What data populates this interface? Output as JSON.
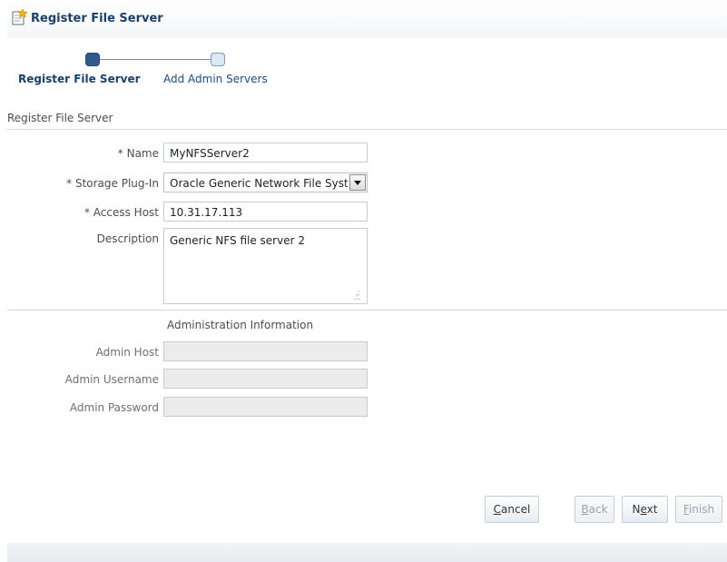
{
  "dialog": {
    "title": "Register File Server",
    "icon": "register-server-icon"
  },
  "train": {
    "steps": [
      {
        "label": "Register File Server",
        "state": "active"
      },
      {
        "label": "Add Admin Servers",
        "state": "inactive"
      }
    ]
  },
  "section": {
    "header": "Register File Server"
  },
  "form": {
    "name": {
      "label": "* Name",
      "value": "MyNFSServer2"
    },
    "storage_plugin": {
      "label": "* Storage Plug-In",
      "value": "Oracle Generic Network File System"
    },
    "access_host": {
      "label": "* Access Host",
      "value": "10.31.17.113"
    },
    "description": {
      "label": "Description",
      "value": "Generic NFS file server 2"
    }
  },
  "admin": {
    "header": "Administration Information",
    "host": {
      "label": "Admin Host",
      "value": ""
    },
    "username": {
      "label": "Admin Username",
      "value": ""
    },
    "password": {
      "label": "Admin Password",
      "value": ""
    }
  },
  "buttons": {
    "cancel": {
      "pre": "",
      "u": "C",
      "post": "ancel",
      "enabled": true
    },
    "back": {
      "pre": "",
      "u": "B",
      "post": "ack",
      "enabled": false
    },
    "next": {
      "pre": "N",
      "u": "e",
      "post": "xt",
      "enabled": true
    },
    "finish": {
      "pre": "",
      "u": "F",
      "post": "inish",
      "enabled": false
    }
  },
  "colors": {
    "accent": "#1b3f6b",
    "active_step": "#2f5a8e",
    "inactive_step": "#dde8f6"
  }
}
